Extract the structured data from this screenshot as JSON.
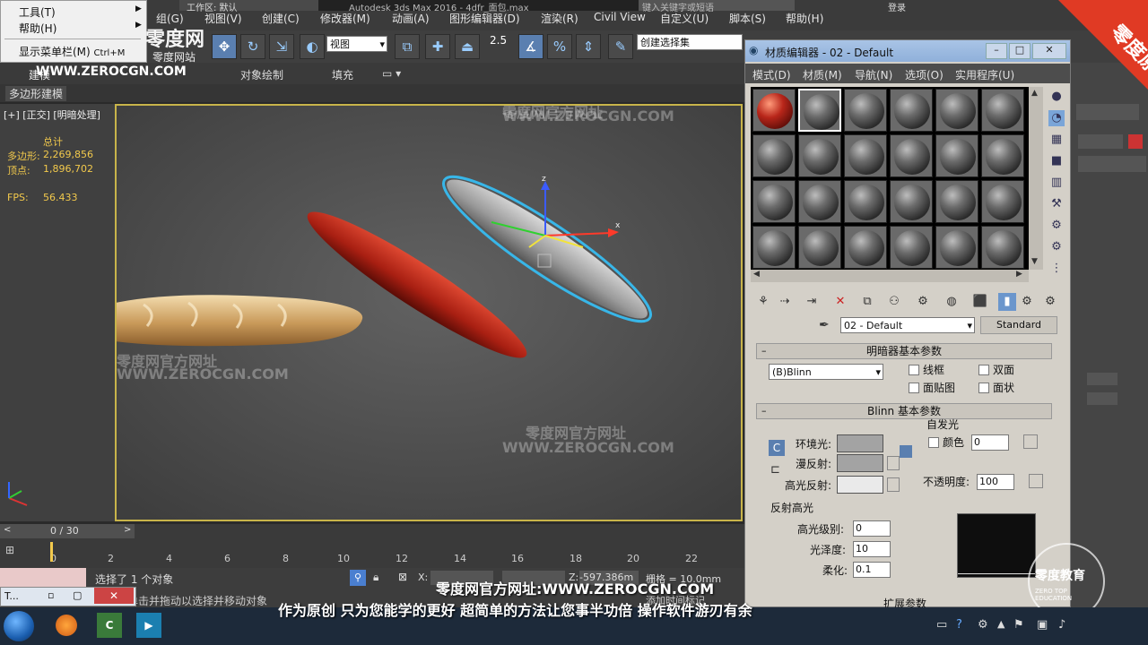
{
  "popup_menu": {
    "tools": "工具(T)",
    "help": "帮助(H)",
    "show_menubar": "显示菜单栏(M)",
    "shortcut": "Ctrl+M"
  },
  "menubar": {
    "workspace": "工作区: 默认",
    "app_title": "Autodesk 3ds Max 2016 - ",
    "file_name": "4dfr_面包.max",
    "search_placeholder": "键入关键字或短语",
    "login": "登录",
    "items": [
      "组(G)",
      "视图(V)",
      "创建(C)",
      "修改器(M)",
      "动画(A)",
      "图形编辑器(D)",
      "渲染(R)",
      "Civil View",
      "自定义(U)",
      "脚本(S)",
      "帮助(H)"
    ]
  },
  "toolbar": {
    "view_dropdown": "视图",
    "selection_set": "创建选择集",
    "snap_value": "2.5"
  },
  "ribbon": {
    "tabs": [
      "建模",
      "对象绘制",
      "填充"
    ],
    "sub_label": "多边形建模"
  },
  "viewport": {
    "label": "[+] [正交] [明暗处理]",
    "stats_header": "总计",
    "polys_label": "多边形:",
    "polys_value": "2,269,856",
    "verts_label": "顶点:",
    "verts_value": "1,896,702",
    "fps_label": "FPS:",
    "fps_value": "56.433"
  },
  "timeline": {
    "frame_display": "0 / 30",
    "ticks": [
      "0",
      "2",
      "4",
      "6",
      "8",
      "10",
      "12",
      "14",
      "16",
      "18",
      "20",
      "22"
    ]
  },
  "status": {
    "selected": "选择了 1 个对象",
    "hint": "单击或单击并拖动以选择并移动对象",
    "x_label": "X:",
    "z_label": "Z:",
    "z_value": "-597.386m",
    "grid_label": "栅格 = 10.0mm",
    "add_time_tag": "添加时间标记"
  },
  "material_editor": {
    "title": "材质编辑器 - 02 - Default",
    "menu": [
      "模式(D)",
      "材质(M)",
      "导航(N)",
      "选项(O)",
      "实用程序(U)"
    ],
    "material_name": "02 - Default",
    "material_type": "Standard",
    "shader_rollout": "明暗器基本参数",
    "shader_type": "(B)Blinn",
    "wire": "线框",
    "two_sided": "双面",
    "face_map": "面贴图",
    "faceted": "面状",
    "blinn_rollout": "Blinn 基本参数",
    "self_illum": "自发光",
    "color_label": "颜色",
    "color_value": "0",
    "ambient": "环境光:",
    "diffuse": "漫反射:",
    "specular": "高光反射:",
    "opacity_label": "不透明度:",
    "opacity_value": "100",
    "spec_highlights": "反射高光",
    "spec_level_label": "高光级别:",
    "spec_level_value": "0",
    "glossiness_label": "光泽度:",
    "glossiness_value": "10",
    "soften_label": "柔化:",
    "soften_value": "0.1",
    "extended": "扩展参数"
  },
  "watermarks": {
    "site_cn": "零度网官方网址",
    "site_url": "WWW.ZEROCGN.COM",
    "brand": "零度网",
    "brand_sub": "零度网站",
    "corner_badge": "零度原创",
    "edu_cn": "零度教育",
    "edu_en": "ZERO TOP EDUCATION",
    "subtitle": "零度网官方网址:WWW.ZEROCGN.COM",
    "slogan": "作为原创 只为您能学的更好 超简单的方法让您事半功倍 操作软件游刃有余"
  },
  "taskbar": {
    "task_label": "T..."
  },
  "colors": {
    "accent": "#5a7fb0",
    "viewport_border": "#c8b44a",
    "stats_yellow": "#f2c94c",
    "selected_outline": "#38b6e8",
    "sausage_red": "#b8261a"
  }
}
